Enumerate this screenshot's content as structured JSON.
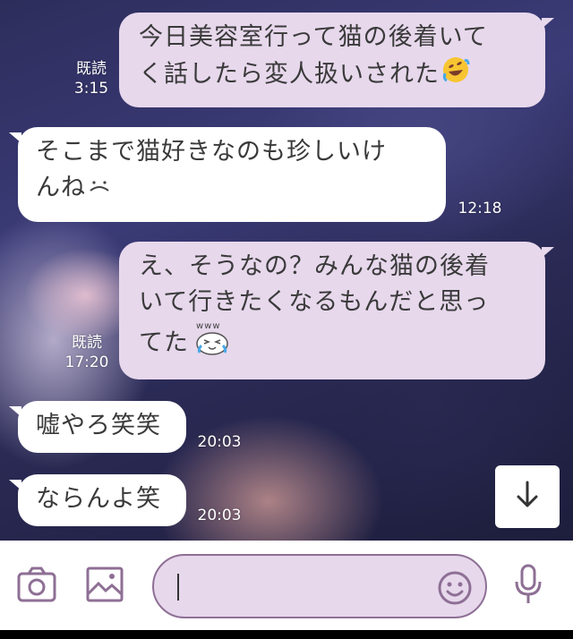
{
  "messages": [
    {
      "id": "m1",
      "side": "out",
      "text_lines": [
        "今日美容室行って猫の後着いて",
        "く話したら変人扱いされた"
      ],
      "emoji": "rofl-emoji",
      "read": "既読",
      "time": "3:15"
    },
    {
      "id": "m2",
      "side": "in",
      "text_lines": [
        "そこまで猫好きなのも珍しいけ",
        "んね"
      ],
      "emoji": "sweat-dots-emoji",
      "time": "12:18"
    },
    {
      "id": "m3",
      "side": "out",
      "text_lines": [
        "え、そうなの？みんな猫の後着",
        "いて行きたくなるもんだと思っ",
        "てた"
      ],
      "emoji": "crying-laughing-sticker",
      "emoji_text": "www",
      "read": "既読",
      "time": "17:20"
    },
    {
      "id": "m4",
      "side": "in",
      "text_lines": [
        "嘘やろ笑笑"
      ],
      "time": "20:03"
    },
    {
      "id": "m5",
      "side": "in",
      "text_lines": [
        "ならんよ笑"
      ],
      "time": "20:03"
    }
  ],
  "scroll_button": {
    "icon": "arrow-down-icon"
  },
  "input_bar": {
    "camera_icon": "camera-icon",
    "image_icon": "image-icon",
    "emoji_icon": "smiley-icon",
    "mic_icon": "microphone-icon",
    "value": ""
  },
  "colors": {
    "outgoing_bubble": "#e7d8ec",
    "incoming_bubble": "#ffffff",
    "icon_color": "#8e6f95",
    "timestamp": "#ffffff"
  }
}
